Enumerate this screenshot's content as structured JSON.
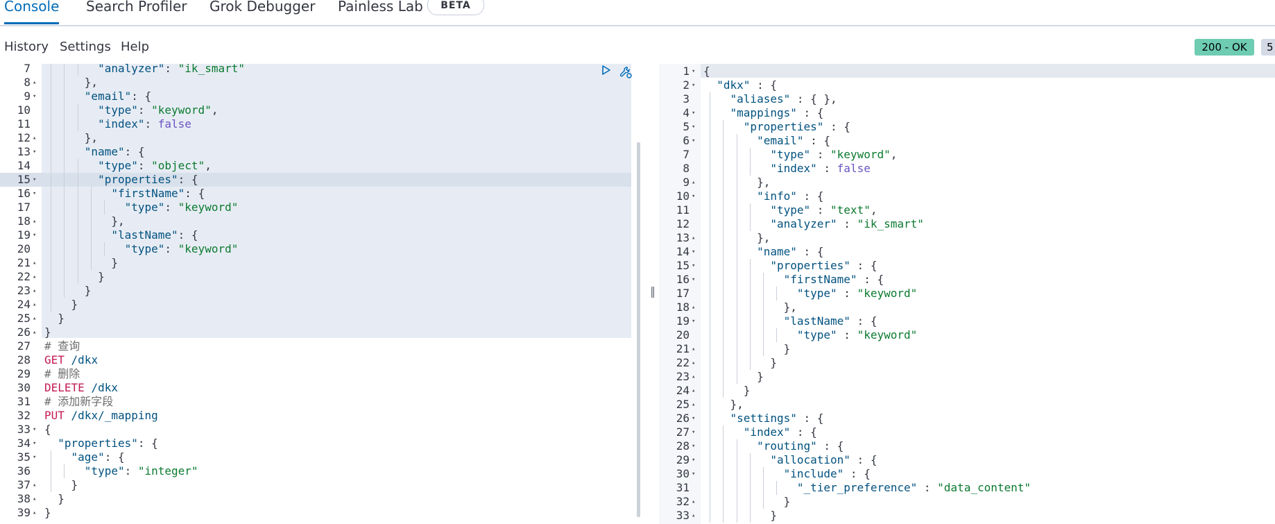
{
  "tabs": [
    "Console",
    "Search Profiler",
    "Grok Debugger",
    "Painless Lab"
  ],
  "beta_badge": "BETA",
  "menu": {
    "history": "History",
    "settings": "Settings",
    "help": "Help"
  },
  "status": {
    "code": "200 - OK",
    "extra": "5"
  },
  "icons": {
    "run": "play-icon",
    "wrench": "wrench-icon",
    "grip": "resize-grip-icon"
  },
  "request_lines": [
    {
      "n": "7",
      "t": "        \"analyzer\": \"ik_smart\""
    },
    {
      "n": "8",
      "t": "      },"
    },
    {
      "n": "9",
      "t": "      \"email\": {"
    },
    {
      "n": "10",
      "t": "        \"type\": \"keyword\","
    },
    {
      "n": "11",
      "t": "        \"index\": false"
    },
    {
      "n": "12",
      "t": "      },"
    },
    {
      "n": "13",
      "t": "      \"name\": {"
    },
    {
      "n": "14",
      "t": "        \"type\": \"object\","
    },
    {
      "n": "15",
      "t": "        \"properties\": {"
    },
    {
      "n": "16",
      "t": "          \"firstName\": {"
    },
    {
      "n": "17",
      "t": "            \"type\": \"keyword\""
    },
    {
      "n": "18",
      "t": "          },"
    },
    {
      "n": "19",
      "t": "          \"lastName\": {"
    },
    {
      "n": "20",
      "t": "            \"type\": \"keyword\""
    },
    {
      "n": "21",
      "t": "          }"
    },
    {
      "n": "22",
      "t": "        }"
    },
    {
      "n": "23",
      "t": "      }"
    },
    {
      "n": "24",
      "t": "    }"
    },
    {
      "n": "25",
      "t": "  }"
    },
    {
      "n": "26",
      "t": "}"
    },
    {
      "n": "27",
      "t": "# 查询"
    },
    {
      "n": "28",
      "t": "GET /dkx"
    },
    {
      "n": "29",
      "t": "# 删除"
    },
    {
      "n": "30",
      "t": "DELETE /dkx"
    },
    {
      "n": "31",
      "t": "# 添加新字段"
    },
    {
      "n": "32",
      "t": "PUT /dkx/_mapping"
    },
    {
      "n": "33",
      "t": "{"
    },
    {
      "n": "34",
      "t": "  \"properties\": {"
    },
    {
      "n": "35",
      "t": "    \"age\": {"
    },
    {
      "n": "36",
      "t": "      \"type\": \"integer\""
    },
    {
      "n": "37",
      "t": "    }"
    },
    {
      "n": "38",
      "t": "  }"
    },
    {
      "n": "39",
      "t": "}"
    }
  ],
  "response_lines": [
    {
      "n": "1",
      "t": "{"
    },
    {
      "n": "2",
      "t": "  \"dkx\" : {"
    },
    {
      "n": "3",
      "t": "    \"aliases\" : { },"
    },
    {
      "n": "4",
      "t": "    \"mappings\" : {"
    },
    {
      "n": "5",
      "t": "      \"properties\" : {"
    },
    {
      "n": "6",
      "t": "        \"email\" : {"
    },
    {
      "n": "7",
      "t": "          \"type\" : \"keyword\","
    },
    {
      "n": "8",
      "t": "          \"index\" : false"
    },
    {
      "n": "9",
      "t": "        },"
    },
    {
      "n": "10",
      "t": "        \"info\" : {"
    },
    {
      "n": "11",
      "t": "          \"type\" : \"text\","
    },
    {
      "n": "12",
      "t": "          \"analyzer\" : \"ik_smart\""
    },
    {
      "n": "13",
      "t": "        },"
    },
    {
      "n": "14",
      "t": "        \"name\" : {"
    },
    {
      "n": "15",
      "t": "          \"properties\" : {"
    },
    {
      "n": "16",
      "t": "            \"firstName\" : {"
    },
    {
      "n": "17",
      "t": "              \"type\" : \"keyword\""
    },
    {
      "n": "18",
      "t": "            },"
    },
    {
      "n": "19",
      "t": "            \"lastName\" : {"
    },
    {
      "n": "20",
      "t": "              \"type\" : \"keyword\""
    },
    {
      "n": "21",
      "t": "            }"
    },
    {
      "n": "22",
      "t": "          }"
    },
    {
      "n": "23",
      "t": "        }"
    },
    {
      "n": "24",
      "t": "      }"
    },
    {
      "n": "25",
      "t": "    },"
    },
    {
      "n": "26",
      "t": "    \"settings\" : {"
    },
    {
      "n": "27",
      "t": "      \"index\" : {"
    },
    {
      "n": "28",
      "t": "        \"routing\" : {"
    },
    {
      "n": "29",
      "t": "          \"allocation\" : {"
    },
    {
      "n": "30",
      "t": "            \"include\" : {"
    },
    {
      "n": "31",
      "t": "              \"_tier_preference\" : \"data_content\""
    },
    {
      "n": "32",
      "t": "            }"
    },
    {
      "n": "33",
      "t": "          }"
    }
  ]
}
